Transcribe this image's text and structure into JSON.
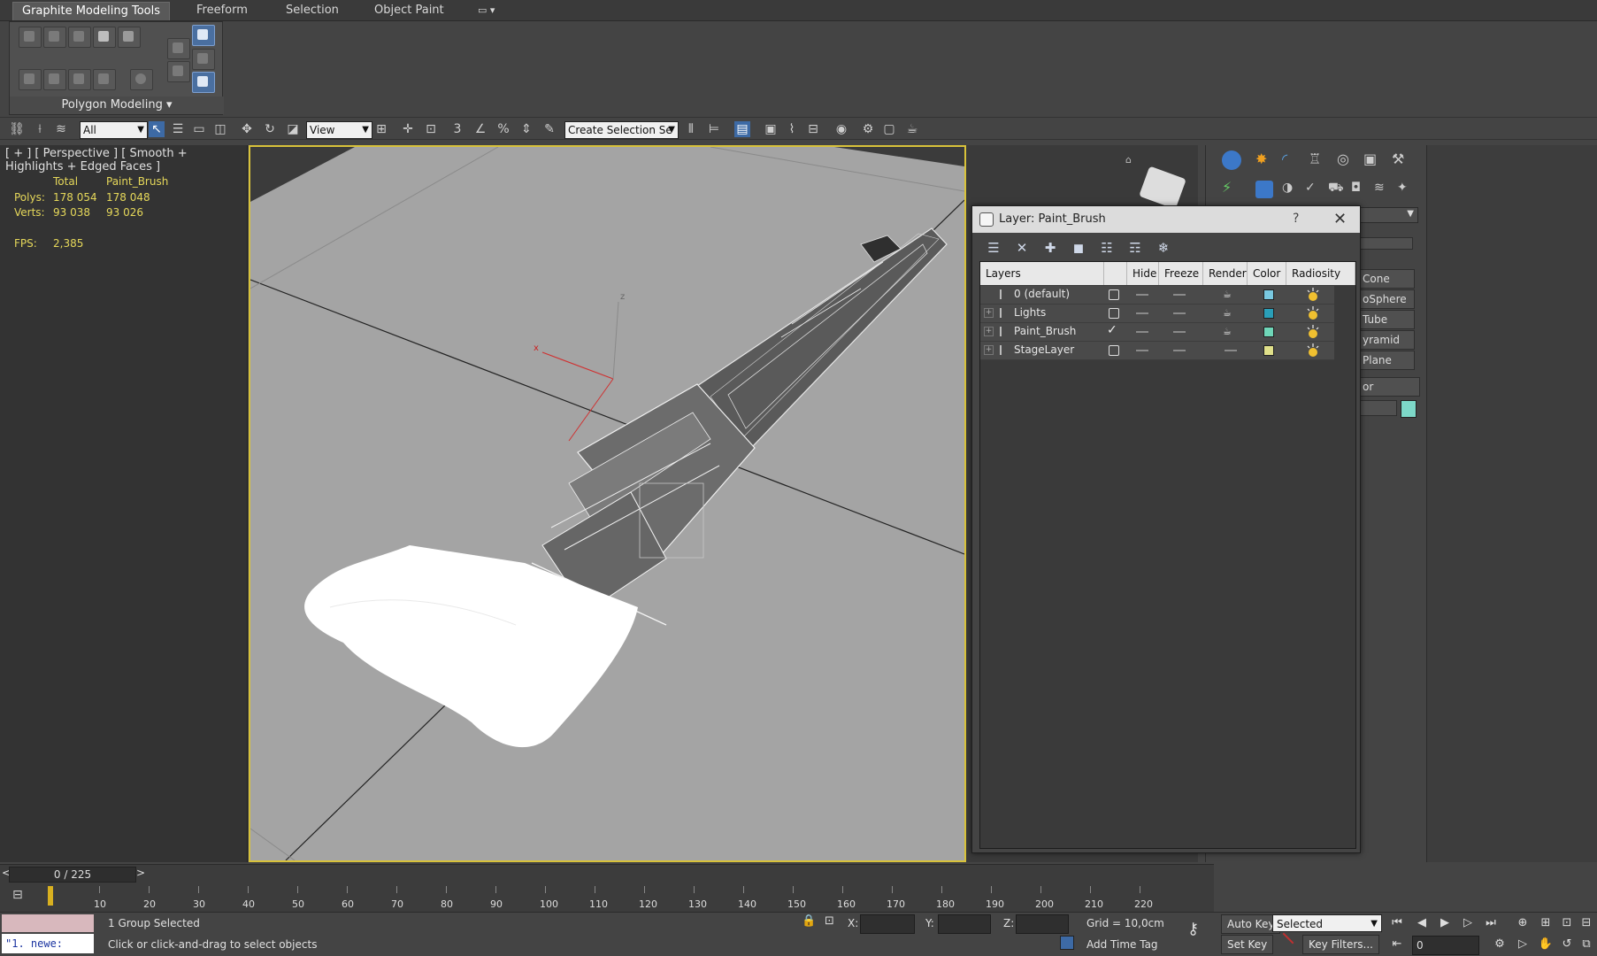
{
  "ribbon": {
    "tabs": [
      "Graphite Modeling Tools",
      "Freeform",
      "Selection",
      "Object Paint"
    ],
    "panel_label": "Polygon Modeling ▾"
  },
  "toolbar": {
    "filter_value": "All",
    "refcoord_value": "View",
    "named_selection_placeholder": "Create Selection Se"
  },
  "viewport": {
    "label": "[ + ] [ Perspective ] [ Smooth + Highlights + Edged Faces ]",
    "stats": {
      "col_total": "Total",
      "col_object": "Paint_Brush",
      "polys_label": "Polys:",
      "polys_total": "178 054",
      "polys_object": "178 048",
      "verts_label": "Verts:",
      "verts_total": "93 038",
      "verts_object": "93 026",
      "fps_label": "FPS:",
      "fps_value": "2,385"
    },
    "axis_x": "x",
    "axis_z": "z"
  },
  "command_panel": {
    "buttons": [
      "Cone",
      "oSphere",
      "Tube",
      "yramid",
      "Plane"
    ],
    "section_label": "or",
    "swatch_color": "#7dd8c8"
  },
  "layer_dialog": {
    "title": "Layer: Paint_Brush",
    "help": "?",
    "close": "✕",
    "columns": [
      "Layers",
      "Hide",
      "Freeze",
      "Render",
      "Color",
      "Radiosity"
    ],
    "rows": [
      {
        "name": "0 (default)",
        "current": false,
        "expandable": false,
        "color": "#79c8e0"
      },
      {
        "name": "Lights",
        "current": false,
        "expandable": true,
        "color": "#2a9fb8"
      },
      {
        "name": "Paint_Brush",
        "current": true,
        "expandable": true,
        "color": "#6fd6b8"
      },
      {
        "name": "StageLayer",
        "current": false,
        "expandable": true,
        "color": "#e0e08a"
      }
    ]
  },
  "timeline": {
    "frame_display": "0 / 225",
    "ticks": [
      "10",
      "20",
      "30",
      "40",
      "50",
      "60",
      "70",
      "80",
      "90",
      "100",
      "110",
      "120",
      "130",
      "140",
      "150",
      "160",
      "170",
      "180",
      "190",
      "200",
      "210",
      "220"
    ],
    "prev": "<",
    "next": ">"
  },
  "status": {
    "script_text": "\"1.   newe:",
    "selection_status": "1 Group Selected",
    "prompt": "Click or click-and-drag to select objects",
    "x_label": "X:",
    "y_label": "Y:",
    "z_label": "Z:",
    "grid": "Grid = 10,0cm",
    "add_time_tag": "Add Time Tag",
    "auto_key": "Auto Key",
    "set_key": "Set Key",
    "selected_dropdown": "Selected",
    "key_filters": "Key Filters...",
    "frame_value": "0"
  }
}
